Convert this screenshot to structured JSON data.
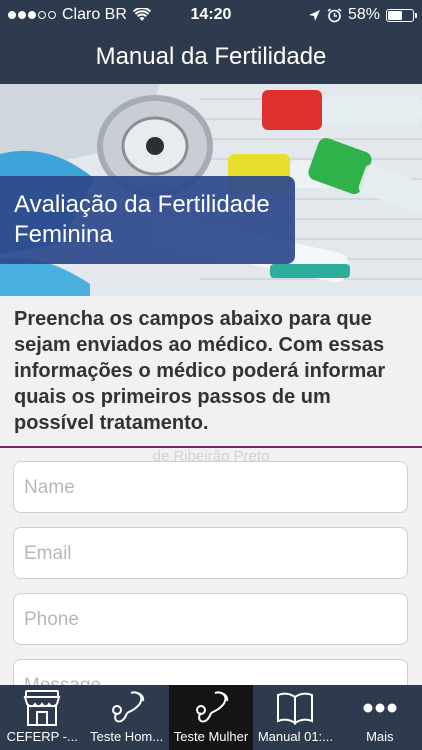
{
  "status_bar": {
    "carrier": "Claro BR",
    "time": "14:20",
    "battery_percent": "58%",
    "battery_level": 0.58,
    "signal_bars_filled": 3,
    "signal_bars_total": 5
  },
  "header": {
    "title": "Manual da Fertilidade"
  },
  "hero": {
    "card_title": "Avaliação da Fertilidade Feminina"
  },
  "intro": {
    "text": "Preencha os campos abaixo para que sejam enviados ao médico. Com essas informações o médico poderá informar quais os primeiros passos de um possível tratamento."
  },
  "form": {
    "ghost_text": "de Ribeirão Preto",
    "fields": [
      {
        "placeholder": "Name"
      },
      {
        "placeholder": "Email"
      },
      {
        "placeholder": "Phone"
      },
      {
        "placeholder": "Message"
      }
    ]
  },
  "tabs": [
    {
      "label": "CEFERP -...",
      "icon": "storefront-icon",
      "active": false
    },
    {
      "label": "Teste Hom...",
      "icon": "stethoscope-icon",
      "active": false
    },
    {
      "label": "Teste Mulher",
      "icon": "stethoscope-icon",
      "active": true
    },
    {
      "label": "Manual 01:...",
      "icon": "book-icon",
      "active": false
    },
    {
      "label": "Mais",
      "icon": "more-icon",
      "active": false
    }
  ],
  "colors": {
    "bar_background": "#2e3a4d",
    "active_tab": "#141414",
    "hero_card": "#2d488c",
    "divider": "#7a2a5a"
  }
}
